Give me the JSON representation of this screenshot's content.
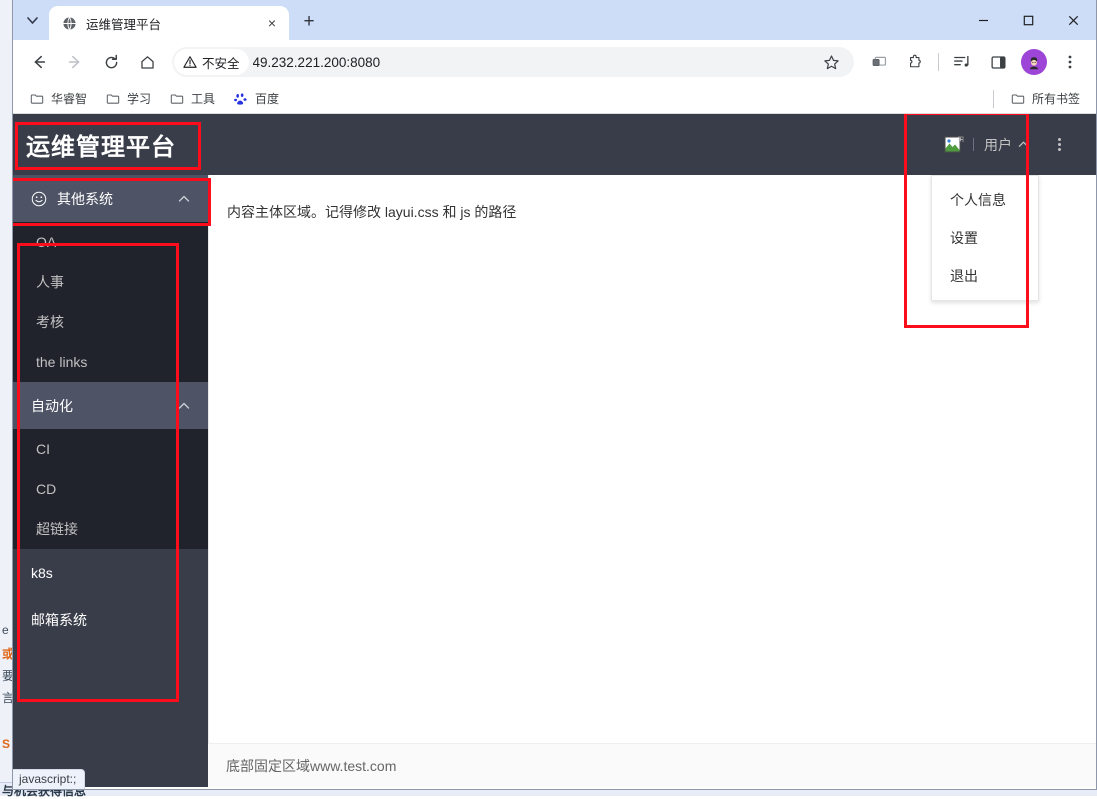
{
  "browser": {
    "tab": {
      "title": "运维管理平台",
      "favicon": "globe-icon",
      "close_label": "×"
    },
    "new_tab_label": "+",
    "window_controls": {
      "minimize": "—",
      "maximize": "□",
      "close": "✕"
    },
    "toolbar": {
      "back": "back-arrow-icon",
      "forward": "forward-arrow-icon",
      "reload": "reload-icon",
      "home": "home-icon",
      "security_label": "不安全",
      "url": "49.232.221.200:8080",
      "star": "star-icon",
      "cast": "cast-icon",
      "extensions": "puzzle-icon",
      "media": "media-list-icon",
      "side_panel": "side-panel-icon",
      "profile": "profile-avatar-icon",
      "menu": "kebab-menu-icon"
    },
    "bookmarks": {
      "items": [
        {
          "label": "华睿智",
          "icon": "folder-icon"
        },
        {
          "label": "学习",
          "icon": "folder-icon"
        },
        {
          "label": "工具",
          "icon": "folder-icon"
        },
        {
          "label": "百度",
          "icon": "baidu-icon"
        }
      ],
      "all_bookmarks_label": "所有书签",
      "all_bookmarks_icon": "folder-icon"
    },
    "status_bubble": "javascript:;"
  },
  "app": {
    "logo": "运维管理平台",
    "header": {
      "avatar_icon": "broken-image-icon",
      "user_label": "用户",
      "chevron": "chevron-up-icon",
      "kebab": "kebab-menu-icon"
    },
    "user_dropdown": {
      "items": [
        {
          "label": "个人信息"
        },
        {
          "label": "设置"
        },
        {
          "label": "退出"
        }
      ]
    },
    "sidebar": {
      "groups": [
        {
          "label": "其他系统",
          "icon": "smiley-face-icon",
          "arrow": "chevron-up-icon",
          "open": true,
          "children": [
            {
              "label": "OA"
            },
            {
              "label": "人事"
            },
            {
              "label": "考核"
            },
            {
              "label": "the links"
            }
          ]
        },
        {
          "label": "自动化",
          "icon": "",
          "arrow": "chevron-up-icon",
          "open": true,
          "children": [
            {
              "label": "CI"
            },
            {
              "label": "CD"
            },
            {
              "label": "超链接"
            }
          ]
        }
      ],
      "tail_items": [
        {
          "label": "k8s"
        },
        {
          "label": "邮箱系统"
        }
      ]
    },
    "content": {
      "text": "内容主体区域。记得修改 layui.css 和 js 的路径"
    },
    "footer": {
      "text": "底部固定区域www.test.com"
    }
  },
  "background_window": {
    "lines": [
      {
        "text": "e",
        "cls": ""
      },
      {
        "text": "或",
        "cls": "orange"
      },
      {
        "text": "要",
        "cls": ""
      },
      {
        "text": "言",
        "cls": ""
      },
      {
        "text": "S",
        "cls": "orange"
      }
    ],
    "bottom_text": "与机会获得信息"
  },
  "colors": {
    "app_dark": "#393d49",
    "submenu_dark": "#20222c",
    "nav_open": "#4e5465",
    "annotation_red": "#fc0d1b",
    "tabstrip_blue": "#cdddf7",
    "profile_purple": "#9c45d6"
  }
}
